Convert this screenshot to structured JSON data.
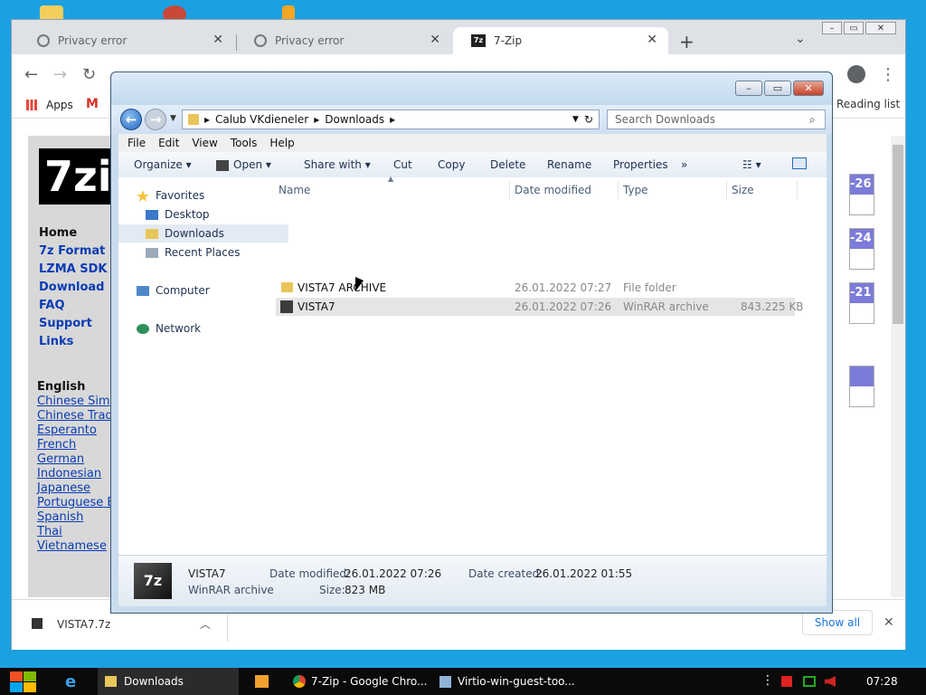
{
  "chrome": {
    "tabs": [
      {
        "label": "Privacy error",
        "active": false
      },
      {
        "label": "Privacy error",
        "active": false
      },
      {
        "label": "7-Zip",
        "active": true
      }
    ],
    "new_tab_icon": "+",
    "bookmarks": {
      "apps": "Apps",
      "reading_list": "Reading list"
    },
    "download_item": "VISTA7.7z",
    "show_all": "Show all"
  },
  "site": {
    "nav": [
      "Home",
      "7z Format",
      "LZMA SDK",
      "Download",
      "FAQ",
      "Support",
      "Links"
    ],
    "lang_header": "English",
    "languages": [
      "Chinese Sim",
      "Chinese Trad",
      "Esperanto",
      "French",
      "German",
      "Indonesian",
      "Japanese",
      "Portuguese B",
      "Spanish",
      "Thai",
      "Vietnamese"
    ],
    "version_fragments": [
      "-26",
      "-24",
      "-21",
      ""
    ],
    "logo_text": "7zi"
  },
  "explorer": {
    "breadcrumb": [
      "Calub VKdieneler",
      "Downloads"
    ],
    "search_placeholder": "Search Downloads",
    "menu": [
      "File",
      "Edit",
      "View",
      "Tools",
      "Help"
    ],
    "toolbar": {
      "organize": "Organize",
      "open": "Open",
      "share_with": "Share with",
      "cut": "Cut",
      "copy": "Copy",
      "delete": "Delete",
      "rename": "Rename",
      "properties": "Properties",
      "more": "»"
    },
    "nav_pane": {
      "favorites": "Favorites",
      "desktop": "Desktop",
      "downloads": "Downloads",
      "recent": "Recent Places",
      "computer": "Computer",
      "network": "Network"
    },
    "columns": {
      "name": "Name",
      "date_modified": "Date modified",
      "type": "Type",
      "size": "Size"
    },
    "files": [
      {
        "name": "VISTA7 ARCHIVE",
        "date": "26.01.2022 07:27",
        "type": "File folder",
        "size": ""
      },
      {
        "name": "VISTA7",
        "date": "26.01.2022 07:26",
        "type": "WinRAR archive",
        "size": "843.225 KB"
      }
    ],
    "details": {
      "name": "VISTA7",
      "type": "WinRAR archive",
      "date_modified_label": "Date modified:",
      "date_modified": "26.01.2022 07:26",
      "size_label": "Size:",
      "size": "823 MB",
      "date_created_label": "Date created:",
      "date_created": "26.01.2022 01:55"
    }
  },
  "taskbar": {
    "items": [
      "Downloads",
      "7-Zip - Google Chro...",
      "Virtio-win-guest-too..."
    ],
    "clock": "07:28"
  },
  "colors": {
    "desktop": "#1ba1e2",
    "link": "#0a3cb4",
    "version_header": "#7b7bd9"
  }
}
